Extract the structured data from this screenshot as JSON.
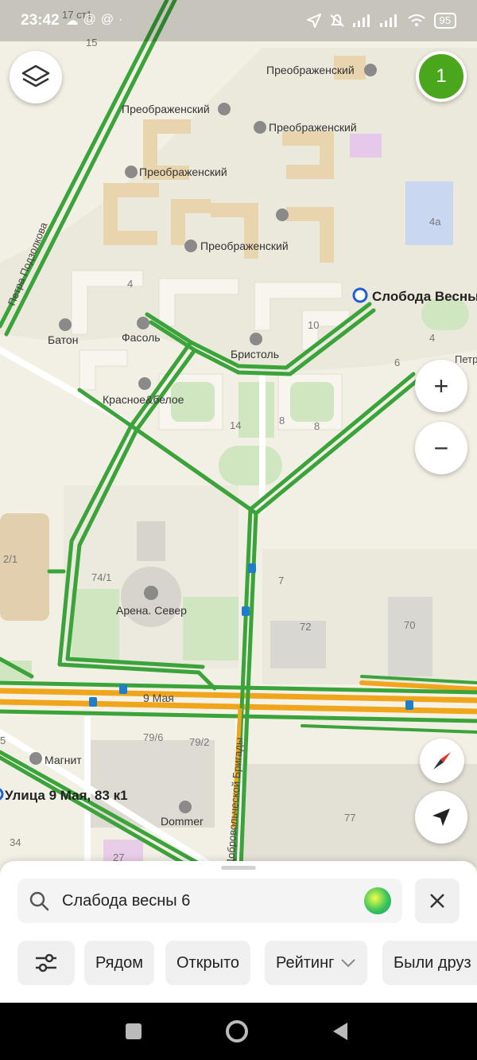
{
  "status_bar": {
    "time": "23:42",
    "battery": "95",
    "left_icons": [
      "cloud-icon",
      "at-icon",
      "at-icon",
      "dot-icon"
    ],
    "right_icons": [
      "location-icon",
      "mute-icon",
      "signal-icon",
      "signal-icon",
      "wifi-icon",
      "battery-icon"
    ]
  },
  "map": {
    "layers_icon": "layers-icon",
    "badge_count": "1",
    "zoom_in": "+",
    "zoom_out": "−",
    "poi": {
      "preobr_1": "Преображенский",
      "preobr_2": "Преображенский",
      "preobr_3": "Преображенский",
      "preobr_4": "Преображенский",
      "preobr_5": "Преображенский",
      "baton": "Батон",
      "fasol": "Фасоль",
      "bristol": "Бристоль",
      "krasnoe": "Красное&белое",
      "arena": "Арена. Север",
      "magnit": "Магнит",
      "dommer": "Dommer",
      "sloboda": "Слобода Весны",
      "address": "Улица 9 Мая, 83 к1"
    },
    "streets": {
      "petra": "Петра Подзолкова",
      "petra_right": "Петра",
      "may9": "9 Мая",
      "brigady": "Добровольческой Бригады"
    },
    "house_numbers": {
      "h17": "17 ст1",
      "h15": "15",
      "h4a": "4а",
      "h4_left": "4",
      "h10": "10",
      "h4_right": "4",
      "h6": "6",
      "h14": "14",
      "h8a": "8",
      "h8b": "8",
      "h2_1": "2/1",
      "h74_1": "74/1",
      "h7": "7",
      "h72": "72",
      "h70": "70",
      "h79_6": "79/6",
      "h79_2": "79/2",
      "h77": "77",
      "h34": "34",
      "h27": "27",
      "h5": "5"
    },
    "colors": {
      "traffic_green": "#3aa33a",
      "traffic_orange": "#f0a61c",
      "badge": "#4aa61c",
      "marker_blue": "#1e5fd6"
    }
  },
  "search": {
    "query": "Слабода весны 6",
    "search_icon": "search-icon",
    "assistant_icon": "alice-icon",
    "clear_icon": "close-icon"
  },
  "filters": {
    "settings_icon": "filter-icon",
    "nearby": "Рядом",
    "open": "Открыто",
    "rating": "Рейтинг",
    "friends": "Были друз"
  },
  "nav": {
    "recent": "square-icon",
    "home": "circle-icon",
    "back": "triangle-back-icon"
  }
}
